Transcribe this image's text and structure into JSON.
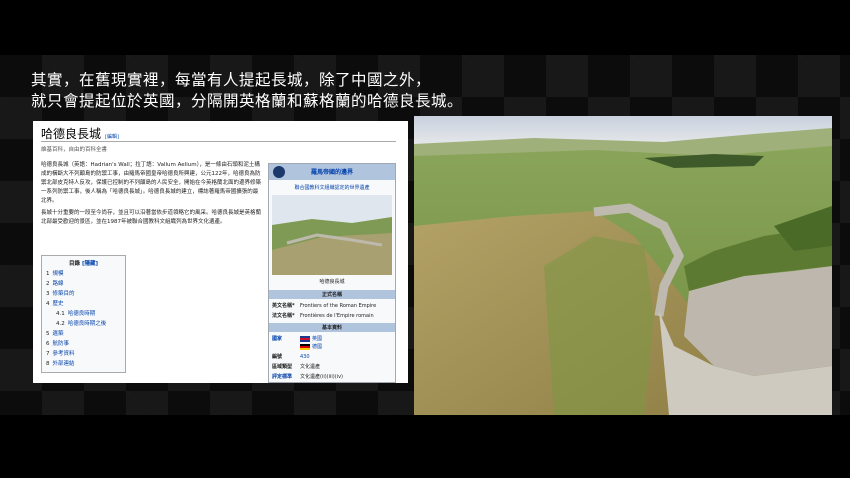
{
  "caption": {
    "line1": "其實，在舊現實裡，每當有人提起長城，除了中國之外，",
    "line2": "就只會提起位於英國，分隔開英格蘭和蘇格蘭的哈德良長城。"
  },
  "wiki": {
    "title": "哈德良長城",
    "edit": "[編輯]",
    "subtitle": "維基百科，自由的百科全書",
    "p1": "哈德良長城（英語：Hadrian's Wall；拉丁語：Vallum Aelium），是一條由石頭和泥土構成的橫斷大不列顛島的防禦工事，由羅馬帝國皇帝哈德良所興建，公元122年，哈德良為防禦北部皮克特人反攻，保護已控制的不列顛島的人民安全，開始在今英格蘭北面的邊界修築一系列防禦工事，後人稱為「哈德良長城」。哈德良長城的建立，標誌著羅馬帝國擴張的最北界。",
    "p2": "長城十分重要的一段至今尚存，並且可以沿著當依步道領略它的風采。哈德良長城是英格蘭北部最受歡迎的景區，並在1987年被聯合國教科文組織列為世界文化遺產。",
    "toc": {
      "title": "目錄",
      "hide": "[隱藏]",
      "items": [
        {
          "num": "1",
          "label": "規模"
        },
        {
          "num": "2",
          "label": "路線"
        },
        {
          "num": "3",
          "label": "修築目的"
        },
        {
          "num": "4",
          "label": "歷史"
        },
        {
          "num": "4.1",
          "label": "哈德良時期",
          "sub": true
        },
        {
          "num": "4.2",
          "label": "哈德良時期之後",
          "sub": true
        },
        {
          "num": "5",
          "label": "遺築"
        },
        {
          "num": "6",
          "label": "航防事"
        },
        {
          "num": "7",
          "label": "參考資料"
        },
        {
          "num": "8",
          "label": "外部連結"
        }
      ]
    },
    "infobox": {
      "head": "羅馬帝國的邊界",
      "sub": "聯合國教科文組織認定的世界遺產",
      "caption": "哈德良長城",
      "official_section": "正式名稱",
      "en_key": "英文名稱*",
      "en_val": "Frontiers of the Roman Empire",
      "fr_key": "法文名稱*",
      "fr_val": "Frontières de l'Empire romain",
      "basic_section": "基本資料",
      "country_key": "國家",
      "country_1": "英國",
      "country_2": "德國",
      "number_key": "編號",
      "number_val": "430",
      "region_key": "區域類型",
      "region_val": "文化遺產",
      "criteria_key": "評定標準",
      "criteria_val": "文化遺產(ii)(iii)(iv)"
    }
  },
  "colors": {
    "link": "#0645ad",
    "infobox_head": "#b0c4de",
    "sky": "#d9dde6",
    "grass": "#8fa95a"
  }
}
